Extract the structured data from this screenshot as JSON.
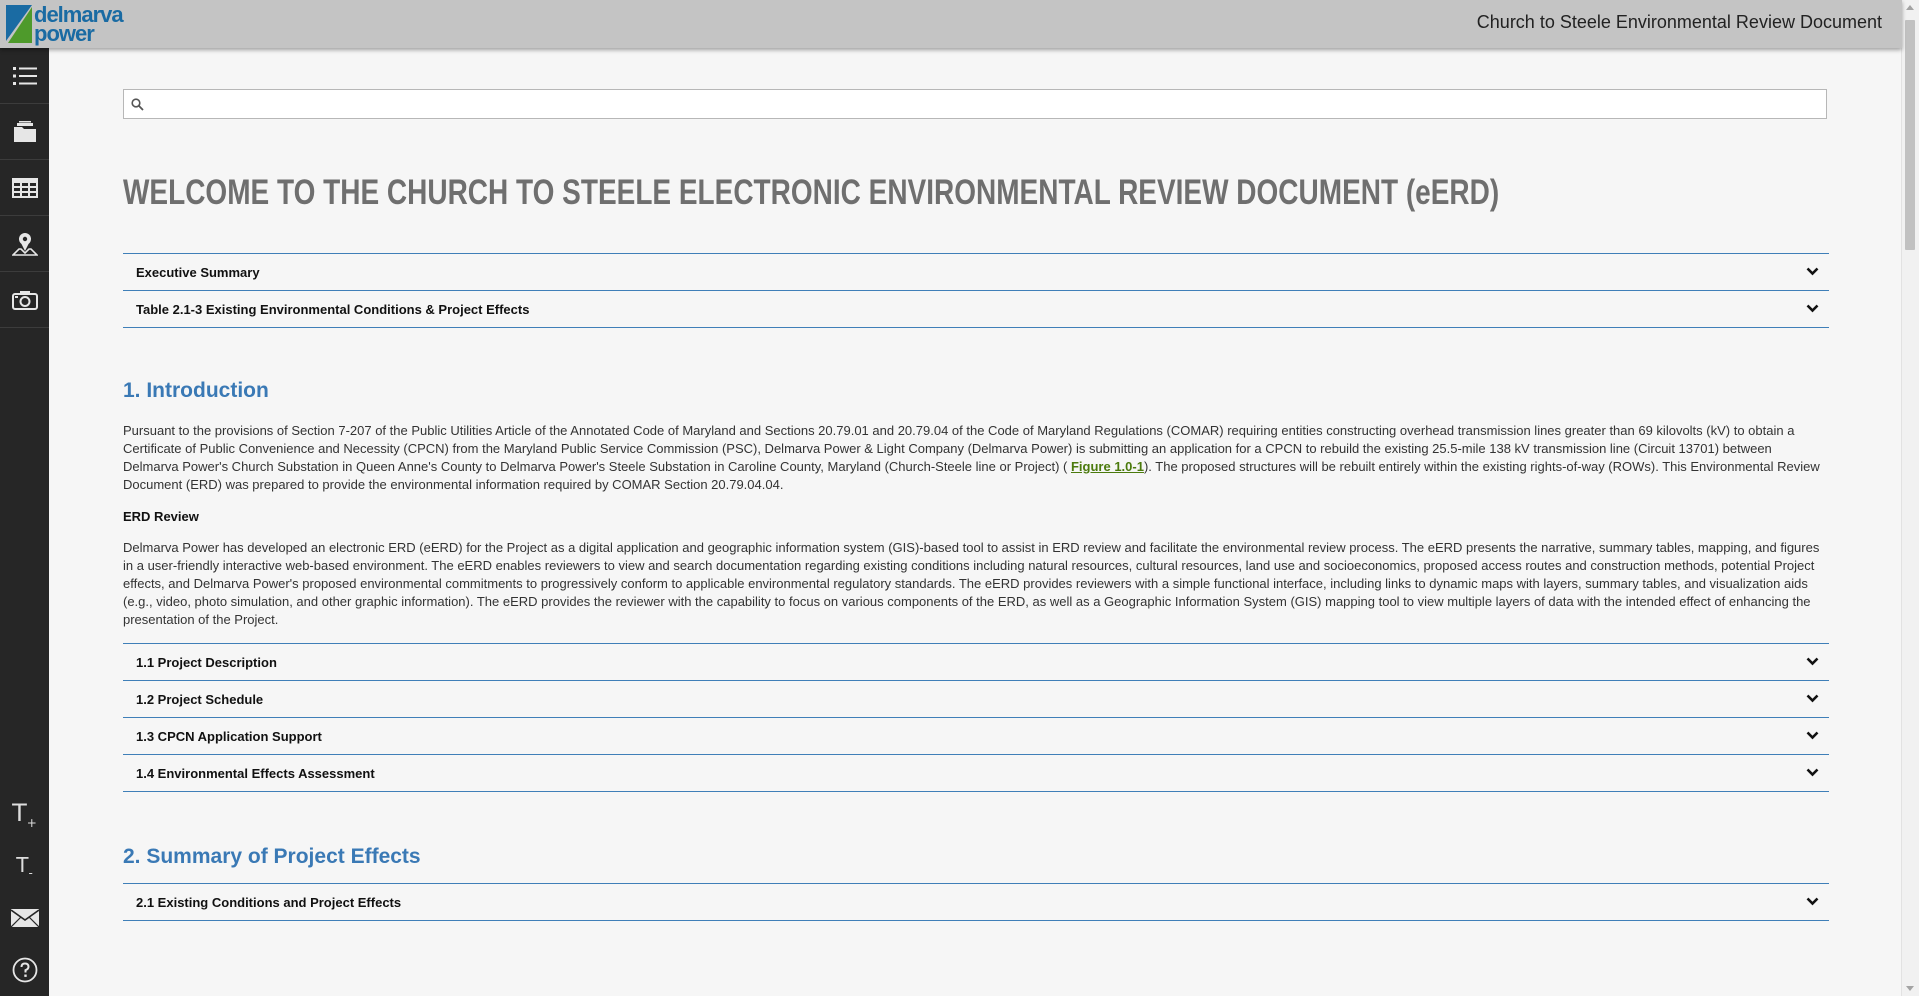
{
  "header": {
    "logo_line1": "delmarva",
    "logo_line2": "power",
    "title": "Church to Steele Environmental Review Document"
  },
  "sidebar": {
    "items": [
      {
        "icon": "list-icon"
      },
      {
        "icon": "folder-icon"
      },
      {
        "icon": "table-icon"
      },
      {
        "icon": "map-pin-icon"
      },
      {
        "icon": "camera-icon"
      }
    ],
    "bottom": [
      {
        "icon": "font-increase-icon",
        "label": "T",
        "sup": "+"
      },
      {
        "icon": "font-decrease-icon",
        "label": "T",
        "sup": "-"
      },
      {
        "icon": "mail-icon"
      },
      {
        "icon": "help-icon"
      }
    ]
  },
  "search": {
    "value": "",
    "placeholder": ""
  },
  "page_title": "WELCOME TO THE CHURCH TO STEELE ELECTRONIC ENVIRONMENTAL REVIEW DOCUMENT (eERD)",
  "top_accordion": [
    "Executive Summary",
    "Table 2.1-3 Existing Environmental Conditions & Project Effects"
  ],
  "section1": {
    "heading": "1. Introduction",
    "para1_a": "Pursuant to the provisions of Section 7-207 of the Public Utilities Article of the Annotated Code of Maryland and Sections 20.79.01 and 20.79.04 of the Code of Maryland Regulations (COMAR) requiring entities constructing overhead transmission lines greater than 69 kilovolts (kV) to obtain a Certificate of Public Convenience and Necessity (CPCN) from the Maryland Public Service Commission (PSC), Delmarva Power & Light Company (Delmarva Power) is submitting an application for a CPCN to rebuild the existing 25.5-mile 138 kV transmission line (Circuit 13701) between Delmarva Power's Church Substation in Queen Anne's County to Delmarva Power's Steele Substation in Caroline County, Maryland (Church-Steele line or Project) ( ",
    "para1_link": "Figure 1.0-1",
    "para1_b": "). The proposed structures will be rebuilt entirely within the existing rights-of-way (ROWs). This Environmental Review Document (ERD) was prepared to provide the environmental information required by COMAR Section 20.79.04.04.",
    "subheading": "ERD Review",
    "para2": "Delmarva Power has developed an electronic ERD (eERD) for the Project as a digital application and geographic information system (GIS)-based tool to assist in ERD review and facilitate the environmental review process. The eERD presents the narrative, summary tables, mapping, and figures in a user-friendly interactive web-based environment. The eERD enables reviewers to view and search documentation regarding existing conditions including natural resources, cultural resources, land use and socioeconomics, proposed access routes and construction methods, potential Project effects, and Delmarva Power's proposed environmental commitments to progressively conform to applicable environmental regulatory standards. The eERD provides reviewers with a simple functional interface, including links to dynamic maps with layers, summary tables, and visualization aids (e.g., video, photo simulation, and other graphic information). The eERD provides the reviewer with the capability to focus on various components of the ERD, as well as a Geographic Information System (GIS) mapping tool to view multiple layers of data with the intended effect of enhancing the presentation of the Project.",
    "accordion": [
      "1.1 Project Description",
      "1.2 Project Schedule",
      "1.3 CPCN Application Support",
      "1.4 Environmental Effects Assessment"
    ]
  },
  "section2": {
    "heading": "2. Summary of Project Effects",
    "accordion": [
      "2.1 Existing Conditions and Project Effects"
    ]
  },
  "colors": {
    "header_bg": "#c4c4c4",
    "sidebar_bg": "#262626",
    "accent_blue": "#3a79b5",
    "link_green": "#4b7a0c",
    "title_gray": "#6f6f6f"
  }
}
